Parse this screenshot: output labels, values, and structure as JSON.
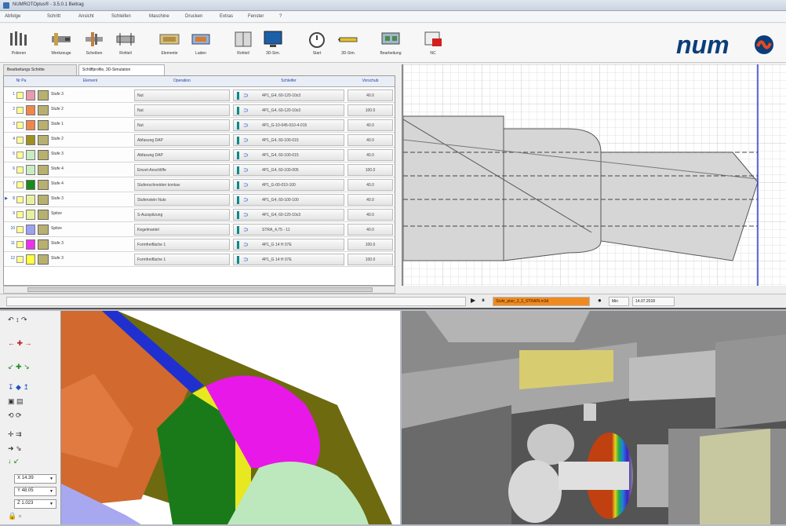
{
  "window": {
    "title": "NUMROTOplus® - 3.5.0.1 Beitrag"
  },
  "menu": [
    {
      "label": "Abfolge"
    },
    {
      "label": "Schritt"
    },
    {
      "label": "Ansicht"
    },
    {
      "label": "Schleifen"
    },
    {
      "label": "Maschine"
    },
    {
      "label": "Drucken"
    },
    {
      "label": "Extras"
    },
    {
      "label": "Fenster"
    },
    {
      "label": "?"
    }
  ],
  "toolbar": [
    {
      "label": "Polieren"
    },
    {
      "label": "Werkzeuge"
    },
    {
      "label": "Scheiben"
    },
    {
      "label": "Rohteil"
    },
    {
      "label": "Elemente"
    },
    {
      "label": "Laden"
    },
    {
      "label": "Rohteil"
    },
    {
      "label": "3D-Sim."
    },
    {
      "label": "Start"
    },
    {
      "label": "3D-Sim."
    },
    {
      "label": "Bearbeitung"
    },
    {
      "label": "NC"
    }
  ],
  "brand": {
    "logo_text": "num",
    "color": "#0a3e7a",
    "accent": "#e84a1a"
  },
  "tabs": [
    {
      "label": "Bearbeitungs Schritte"
    },
    {
      "label": "Schliffprofile, 3D-Simulation"
    }
  ],
  "grid": {
    "headers": {
      "num": "Nr Pa",
      "element": "Element",
      "operation": "Operation",
      "tool": "Schleifer",
      "feed": "Vorschub"
    },
    "rows": [
      {
        "num": "1",
        "color": "#e99ab0",
        "element": "Stufe 3",
        "operation": "Nut",
        "tool": "4P1_G4, 60-120-10x3",
        "feed": "40.0",
        "arrow": ""
      },
      {
        "num": "2",
        "color": "#f0874a",
        "element": "Stufe 2",
        "operation": "Nut",
        "tool": "4P1_G4, 60-120-10x3",
        "feed": "100.0",
        "arrow": ""
      },
      {
        "num": "3",
        "color": "#f0874a",
        "element": "Stufe 1",
        "operation": "Nut",
        "tool": "4P1_G-10-045-010-4-015",
        "feed": "40.0",
        "arrow": ""
      },
      {
        "num": "4",
        "color": "#a09020",
        "element": "Stufe 2",
        "operation": "Abfasung DAP",
        "tool": "4P1_G4, 60-100-015",
        "feed": "40.0",
        "arrow": ""
      },
      {
        "num": "5",
        "color": "#c8ecc0",
        "element": "Stufe 3",
        "operation": "Abfasung DAP",
        "tool": "4P1_G4, 60-100-015",
        "feed": "40.0",
        "arrow": ""
      },
      {
        "num": "6",
        "color": "#c8ecc0",
        "element": "Stufe 4",
        "operation": "Einzel-Anschliffe",
        "tool": "4P1_G4, 60-100-005",
        "feed": "100.0",
        "arrow": ""
      },
      {
        "num": "7",
        "color": "#1a8a1a",
        "element": "Stufe 4",
        "operation": "Stufenschneiden konkav",
        "tool": "4P1_G-00-010-100",
        "feed": "40.0",
        "arrow": ""
      },
      {
        "num": "8",
        "color": "#e8f0a0",
        "element": "Stufe 3",
        "operation": "Stufenstein Nuts",
        "tool": "4P1_G4, 60-100-100",
        "feed": "40.0",
        "arrow": "▶"
      },
      {
        "num": "9",
        "color": "#e8f0a0",
        "element": "Spitze",
        "operation": "S-Ausspitzung",
        "tool": "4P1_G4, 60-120-10x3",
        "feed": "40.0",
        "arrow": ""
      },
      {
        "num": "10",
        "color": "#9aa2f4",
        "element": "Spitze",
        "operation": "Kegelmantel",
        "tool": "STRA_4,75 - 11",
        "feed": "40.0",
        "arrow": ""
      },
      {
        "num": "11",
        "color": "#ee30ee",
        "element": "Stufe 3",
        "operation": "Formfreifläche 1",
        "tool": "4P1_G 14 H 07E",
        "feed": "100.0",
        "arrow": ""
      },
      {
        "num": "12",
        "color": "#ffff40",
        "element": "Stufe 3",
        "operation": "Formfreifläche 1",
        "tool": "4P1_G 14 H 07E",
        "feed": "100.0",
        "arrow": ""
      }
    ]
  },
  "status": {
    "file": "Stufe_plan_3_3_STRAIN.m3d",
    "user": "Min",
    "date": "14.07.2018"
  },
  "nav": {
    "inputs": [
      {
        "axis": "X",
        "value": "14.39"
      },
      {
        "axis": "Y",
        "value": "48.05"
      },
      {
        "axis": "Z",
        "value": "1.023"
      }
    ]
  }
}
